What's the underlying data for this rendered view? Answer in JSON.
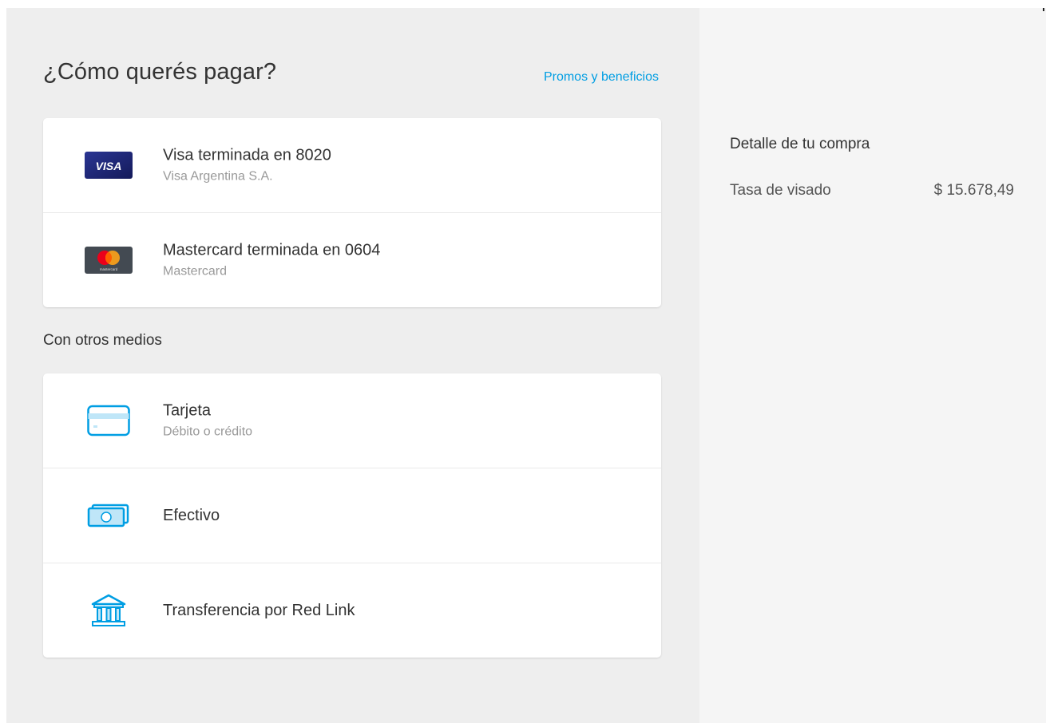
{
  "header": {
    "title": "¿Cómo querés pagar?",
    "promos_link": "Promos y beneficios"
  },
  "saved_cards": [
    {
      "icon": "visa-logo-icon",
      "icon_text": "VISA",
      "title": "Visa terminada en 8020",
      "subtitle": "Visa Argentina S.A."
    },
    {
      "icon": "mastercard-logo-icon",
      "icon_text": "mastercard",
      "title": "Mastercard terminada en 0604",
      "subtitle": "Mastercard"
    }
  ],
  "other_methods": {
    "label": "Con otros medios",
    "items": [
      {
        "icon": "credit-card-icon",
        "title": "Tarjeta",
        "subtitle": "Débito o crédito"
      },
      {
        "icon": "cash-icon",
        "title": "Efectivo"
      },
      {
        "icon": "bank-icon",
        "title": "Transferencia por Red Link"
      }
    ]
  },
  "summary": {
    "title": "Detalle de tu compra",
    "items": [
      {
        "label": "Tasa de visado",
        "amount": "$ 15.678,49"
      }
    ]
  },
  "colors": {
    "accent": "#009ee3",
    "background_main": "#eeeeee",
    "background_sidebar": "#f5f5f5",
    "visa_blue": "#1a1f71",
    "mastercard_red": "#eb001b",
    "mastercard_orange": "#f79e1b"
  }
}
